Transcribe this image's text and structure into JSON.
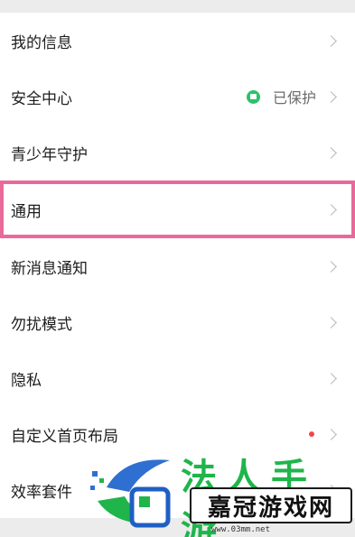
{
  "settings": {
    "items": [
      {
        "label": "我的信息"
      },
      {
        "label": "安全中心",
        "status": "已保护"
      },
      {
        "label": "青少年守护"
      },
      {
        "label": "通用"
      },
      {
        "label": "新消息通知"
      },
      {
        "label": "勿扰模式"
      },
      {
        "label": "隐私"
      },
      {
        "label": "自定义首页布局"
      },
      {
        "label": "效率套件"
      }
    ]
  },
  "watermark": {
    "title": "嘉冠游戏网",
    "url": "www.03mm.net"
  },
  "colors": {
    "highlight": "#e96a9a",
    "shield": "#2cc26a",
    "watermark_green": "#1fb54a"
  }
}
